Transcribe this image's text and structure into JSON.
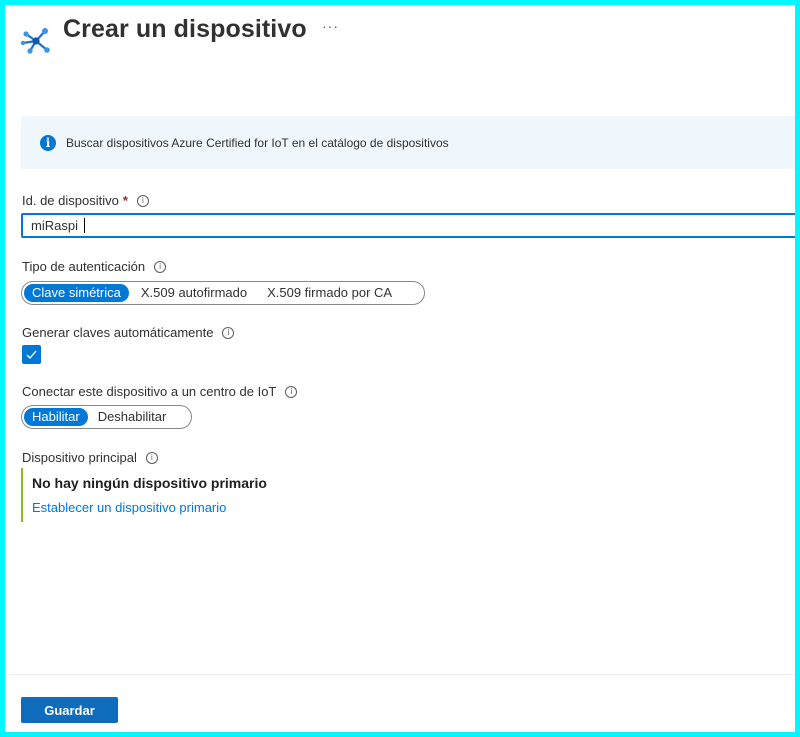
{
  "header": {
    "title": "Crear un dispositivo",
    "more_label": "···"
  },
  "banner": {
    "text": "Buscar dispositivos Azure Certified for IoT en el catálogo de dispositivos",
    "icon_glyph": "i"
  },
  "device_id": {
    "label": "Id. de dispositivo",
    "required_mark": "*",
    "value": "miRaspi"
  },
  "auth_type": {
    "label": "Tipo de autenticación",
    "options": [
      "Clave simétrica",
      "X.509 autofirmado",
      "X.509 firmado por CA"
    ],
    "selected": "Clave simétrica"
  },
  "auto_keys": {
    "label": "Generar claves automáticamente",
    "checked": true
  },
  "connect_hub": {
    "label": "Conectar este dispositivo a un centro de IoT",
    "options": [
      "Habilitar",
      "Deshabilitar"
    ],
    "selected": "Habilitar"
  },
  "parent_device": {
    "label": "Dispositivo principal",
    "empty_text": "No hay ningún dispositivo primario",
    "link_text": "Establecer un dispositivo primario"
  },
  "footer": {
    "save_label": "Guardar"
  },
  "colors": {
    "accent": "#0078d4",
    "frame": "#00f7ff",
    "banner_bg": "#eff6fc",
    "required": "#a4262c",
    "parent_bar": "#8cbd18"
  },
  "icons": {
    "header": "iot-device-icon",
    "banner": "info-icon",
    "help": "info-circle-icon",
    "check": "checkmark-icon"
  }
}
